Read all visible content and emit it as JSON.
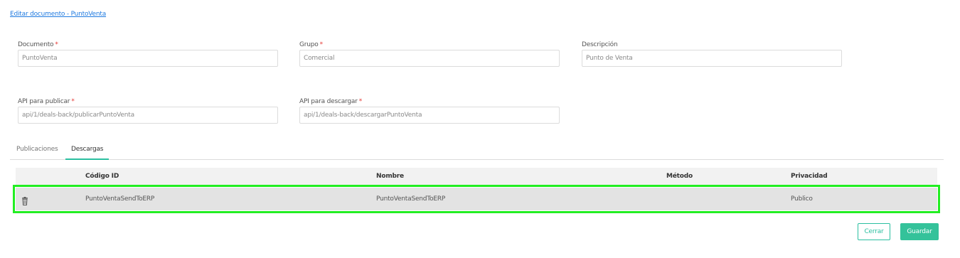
{
  "header": {
    "breadcrumb": "Editar documento - PuntoVenta"
  },
  "form": {
    "documento": {
      "label": "Documento",
      "required_mark": "*",
      "value": "PuntoVenta"
    },
    "grupo": {
      "label": "Grupo",
      "required_mark": "*",
      "value": "Comercial"
    },
    "descripcion": {
      "label": "Descripción",
      "value": "Punto de Venta"
    },
    "api_publicar": {
      "label": "API para publicar",
      "required_mark": "*",
      "value": "api/1/deals-back/publicarPuntoVenta"
    },
    "api_descargar": {
      "label": "API para descargar",
      "required_mark": "*",
      "value": "api/1/deals-back/descargarPuntoVenta"
    }
  },
  "tabs": [
    {
      "label": "Publicaciones",
      "active": false
    },
    {
      "label": "Descargas",
      "active": true
    }
  ],
  "table": {
    "columns": [
      "Código ID",
      "Nombre",
      "Método",
      "Privacidad"
    ],
    "rows": [
      {
        "codigo": "PuntoVentaSendToERP",
        "nombre": "PuntoVentaSendToERP",
        "metodo": "",
        "privacidad": "Publico",
        "action_icon": "trash-icon"
      }
    ]
  },
  "footer": {
    "close_label": "Cerrar",
    "save_label": "Guardar"
  },
  "colors": {
    "accent": "#2bbfa0",
    "save_bg": "#34c29a",
    "link": "#1f7ae0",
    "required": "#e53935",
    "highlight": "#22ee22"
  }
}
